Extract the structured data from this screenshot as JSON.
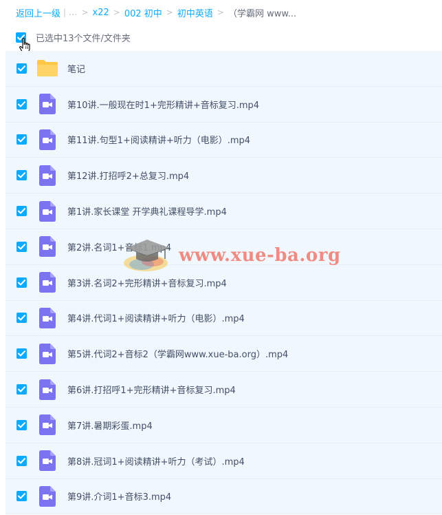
{
  "breadcrumb": {
    "back": "返回上一级",
    "sep1": "|",
    "ellipsis": "...",
    "items": [
      "x22",
      "002 初中",
      "初中英语"
    ],
    "current": "（学霸网 www..."
  },
  "selection": {
    "label": "已选中13个文件/文件夹",
    "checked": true
  },
  "files": [
    {
      "name": "笔记",
      "type": "folder"
    },
    {
      "name": "第10讲.一般现在时1+完形精讲+音标复习.mp4",
      "type": "video"
    },
    {
      "name": "第11讲.句型1+阅读精讲+听力（电影）.mp4",
      "type": "video"
    },
    {
      "name": "第12讲.打招呼2+总复习.mp4",
      "type": "video"
    },
    {
      "name": "第1讲.家长课堂 开学典礼课程导学.mp4",
      "type": "video"
    },
    {
      "name": "第2讲.名词1+音标1.mp4",
      "type": "video"
    },
    {
      "name": "第3讲.名词2+完形精讲+音标复习.mp4",
      "type": "video"
    },
    {
      "name": "第4讲.代词1+阅读精讲+听力（电影）.mp4",
      "type": "video"
    },
    {
      "name": "第5讲.代词2+音标2（学霸网www.xue-ba.org）.mp4",
      "type": "video"
    },
    {
      "name": "第6讲.打招呼1+完形精讲+音标复习.mp4",
      "type": "video"
    },
    {
      "name": "第7讲.暑期彩蛋.mp4",
      "type": "video"
    },
    {
      "name": "第8讲.冠词1+阅读精讲+听力（考试）.mp4",
      "type": "video"
    },
    {
      "name": "第9讲.介词1+音标3.mp4",
      "type": "video"
    }
  ],
  "watermark": {
    "text": "www.xue-ba.org"
  },
  "colors": {
    "accent": "#09aaff",
    "row_bg": "#f1f8fd",
    "folder": "#ffc746",
    "video": "#7b73f0"
  }
}
